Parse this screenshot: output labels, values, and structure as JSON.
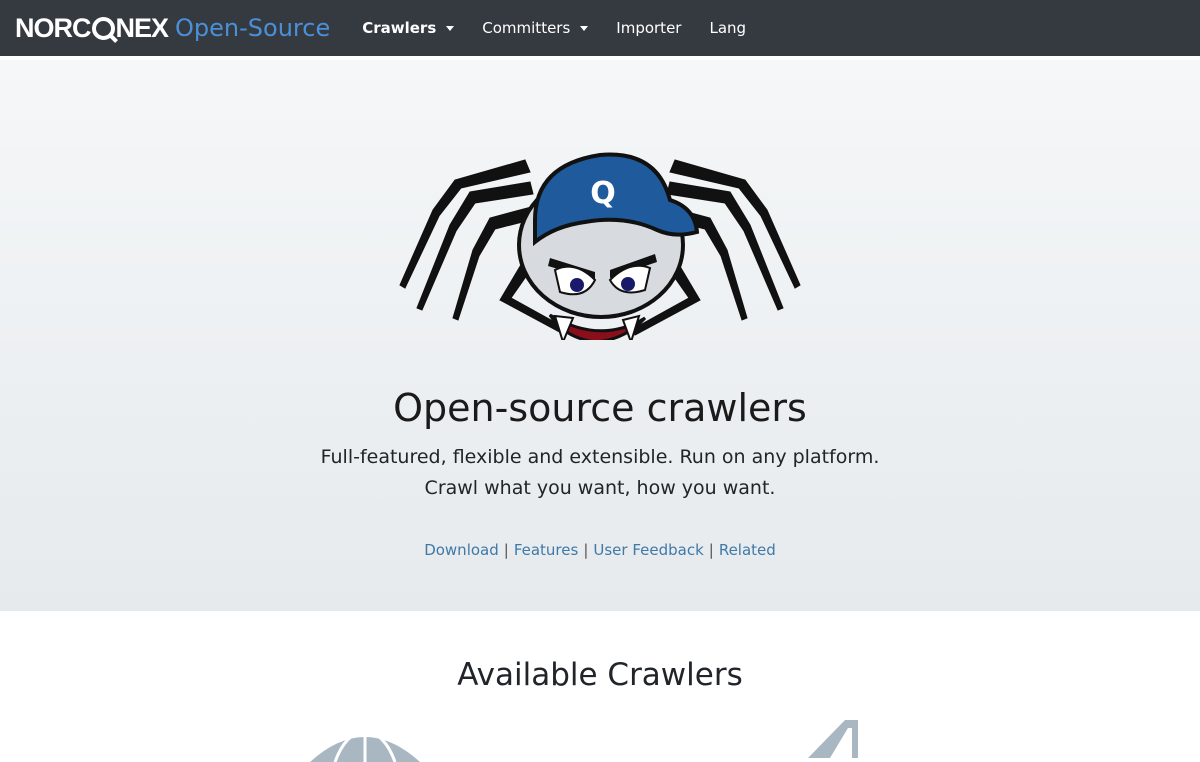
{
  "navbar": {
    "brand_logo_text": "NORCONEX",
    "brand_sub": "Open-Source",
    "items": [
      {
        "label": "Crawlers",
        "dropdown": true,
        "active": true
      },
      {
        "label": "Committers",
        "dropdown": true,
        "active": false
      },
      {
        "label": "Importer",
        "dropdown": false,
        "active": false
      },
      {
        "label": "Lang",
        "dropdown": false,
        "active": false
      }
    ]
  },
  "hero": {
    "mascot_cap_letter": "Q",
    "title": "Open-source crawlers",
    "subtitle_line1": "Full-featured, flexible and extensible. Run on any platform.",
    "subtitle_line2": "Crawl what you want, how you want.",
    "links": [
      {
        "label": "Download"
      },
      {
        "label": "Features"
      },
      {
        "label": "User Feedback"
      },
      {
        "label": "Related"
      }
    ],
    "link_separator": "|"
  },
  "section": {
    "title": "Available Crawlers",
    "icons": [
      "globe-icon",
      "filesystem-icon"
    ]
  },
  "colors": {
    "navbar_bg": "#343a40",
    "brand_accent": "#4a90d9",
    "link": "#3f79a8",
    "cap_blue": "#1e5a9c"
  }
}
